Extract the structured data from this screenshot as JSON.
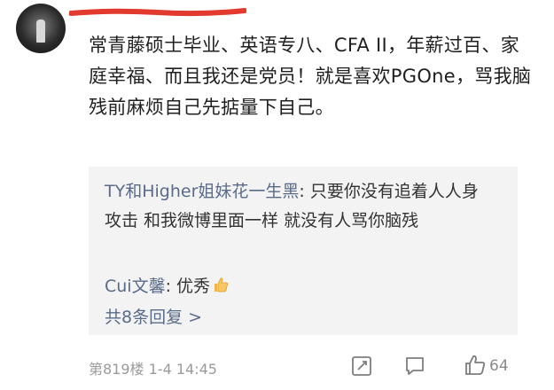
{
  "post": {
    "username": "",
    "text": "常青藤硕士毕业、英语专八、CFA II，年薪过百、家庭幸福、而且我还是党员！就是喜欢PGOne，骂我脑残前麻烦自己先掂量下自己。"
  },
  "replies": [
    {
      "user": "TY和Higher姐妹花一生黑",
      "sep": ": ",
      "text": "只要你没有追着人人身攻击 和我微博里面一样 就没有人骂你脑残"
    },
    {
      "user": "Cui文馨",
      "sep": ": ",
      "text": "优秀"
    }
  ],
  "more_replies": "共8条回复 >",
  "meta": {
    "floor_time": "第819楼 1-4 14:45"
  },
  "actions": {
    "like_count": "64"
  },
  "colors": {
    "accent": "#5a6b8a",
    "reply_bg": "#f3f3f3",
    "meta": "#9a9a9a",
    "redaction": "#e23a2f"
  },
  "icons": [
    "edit-icon",
    "comment-icon",
    "like-icon",
    "thumbs-up-emoji"
  ]
}
